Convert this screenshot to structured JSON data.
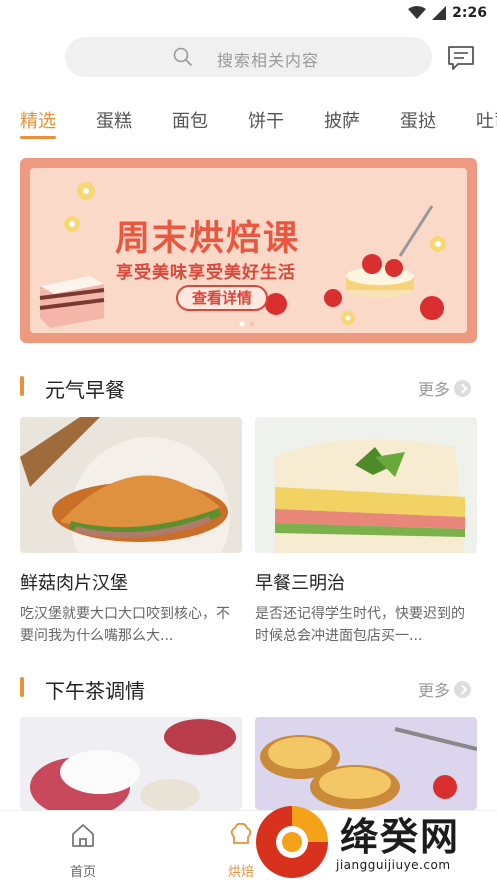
{
  "status": {
    "time": "2:26"
  },
  "search": {
    "placeholder": "搜索相关内容"
  },
  "tabs": [
    {
      "label": "精选",
      "active": true
    },
    {
      "label": "蛋糕"
    },
    {
      "label": "面包"
    },
    {
      "label": "饼干"
    },
    {
      "label": "披萨"
    },
    {
      "label": "蛋挞"
    },
    {
      "label": "吐司"
    }
  ],
  "banner": {
    "title": "周末烘焙课",
    "subtitle": "享受美味享受美好生活",
    "button": "查看详情"
  },
  "sections": [
    {
      "title": "元气早餐",
      "more": "更多",
      "cards": [
        {
          "title": "鲜菇肉片汉堡",
          "desc": "吃汉堡就要大口大口咬到核心，不要问我为什么嘴那么大..."
        },
        {
          "title": "早餐三明治",
          "desc": "是否还记得学生时代，快要迟到的时候总会冲进面包店买一..."
        }
      ]
    },
    {
      "title": "下午茶调情",
      "more": "更多"
    }
  ],
  "nav": [
    {
      "label": "首页"
    },
    {
      "label": "烘焙",
      "active": true
    }
  ],
  "watermark": {
    "name": "绛癸网",
    "url": "jiangguijiuye.com"
  },
  "colors": {
    "accent": "#e8913a",
    "banner": "#ee9a80",
    "banner_text": "#e9573f"
  }
}
